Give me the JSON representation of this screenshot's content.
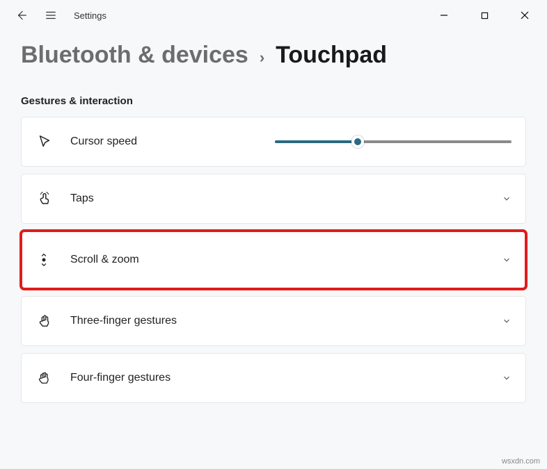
{
  "app": {
    "title": "Settings"
  },
  "breadcrumb": {
    "parent": "Bluetooth & devices",
    "sep": "›",
    "current": "Touchpad"
  },
  "section": {
    "title": "Gestures & interaction"
  },
  "rows": {
    "cursor_speed": {
      "label": "Cursor speed",
      "value_percent": 35
    },
    "taps": {
      "label": "Taps"
    },
    "scroll_zoom": {
      "label": "Scroll & zoom"
    },
    "three_finger": {
      "label": "Three-finger gestures"
    },
    "four_finger": {
      "label": "Four-finger gestures"
    }
  },
  "watermark": "wsxdn.com"
}
